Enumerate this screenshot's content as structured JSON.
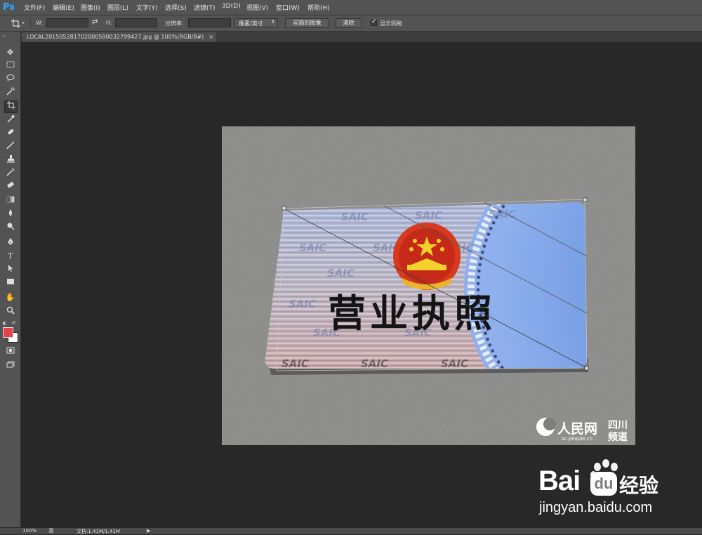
{
  "app": {
    "logo": "Ps"
  },
  "menu": [
    "文件(F)",
    "编辑(E)",
    "图像(I)",
    "图层(L)",
    "文字(Y)",
    "选择(S)",
    "滤镜(T)",
    "3D(D)",
    "视图(V)",
    "窗口(W)",
    "帮助(H)"
  ],
  "options": {
    "w_label": "W:",
    "h_label": "H:",
    "resolution_label": "分辨率:",
    "unit_select": "像素/英寸",
    "front_image_button": "前面的图像",
    "clear_button": "清除",
    "show_grid_label": "显示网格",
    "show_grid_checked": true
  },
  "document": {
    "tab_title": "LOCAL2015052817020005900327994​27.jpg @ 100%(RGB/8#)",
    "close_symbol": "×"
  },
  "image": {
    "license_title": "营业执照",
    "saic": "SAIC",
    "people_logo_text": "人民网",
    "people_url": "sc.people.cn",
    "sichuan_line1": "四川",
    "sichuan_line2": "频道",
    "baidu_text": "Bai",
    "baidu_du": "du",
    "baidu_jingyan": "经验",
    "baidu_url": "jingyan.baidu.com"
  },
  "status": {
    "zoom": "100%",
    "doc_info": "文档:1.41M/1.41M"
  },
  "colors": {
    "foreground": "#e8424a",
    "background": "#ffffff",
    "ps_blue": "#31a8ff"
  },
  "tools": [
    "move-tool-icon",
    "marquee-tool-icon",
    "lasso-tool-icon",
    "magic-wand-icon",
    "crop-tool-icon",
    "eyedropper-icon",
    "healing-brush-icon",
    "brush-tool-icon",
    "clone-stamp-icon",
    "history-brush-icon",
    "eraser-icon",
    "gradient-tool-icon",
    "blur-tool-icon",
    "dodge-tool-icon",
    "pen-tool-icon",
    "type-tool-icon",
    "path-selection-icon",
    "rectangle-tool-icon",
    "hand-tool-icon",
    "zoom-tool-icon"
  ]
}
